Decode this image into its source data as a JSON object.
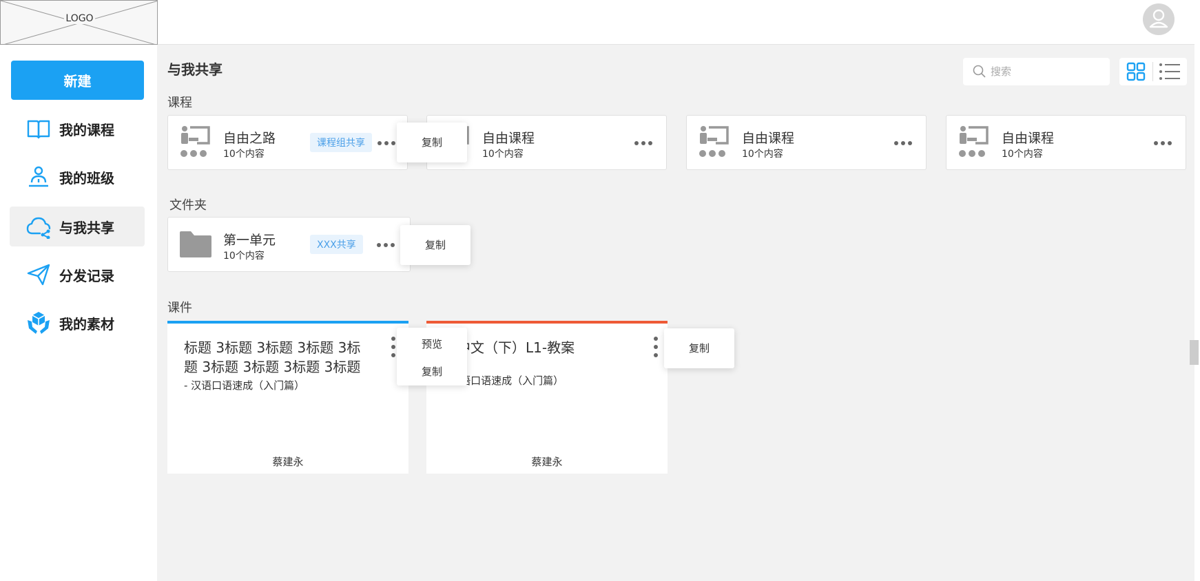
{
  "header": {
    "logo_text": "LOGO"
  },
  "sidebar": {
    "new_label": "新建",
    "items": [
      {
        "label": "我的课程",
        "icon": "book-icon"
      },
      {
        "label": "我的班级",
        "icon": "user-class-icon"
      },
      {
        "label": "与我共享",
        "icon": "cloud-share-icon",
        "active": true
      },
      {
        "label": "分发记录",
        "icon": "paper-plane-icon"
      },
      {
        "label": "我的素材",
        "icon": "material-hands-icon"
      }
    ]
  },
  "main": {
    "title": "与我共享",
    "search_placeholder": "搜索",
    "sections": {
      "courses": "课程",
      "folders": "文件夹",
      "coursewares": "课件"
    },
    "courses": [
      {
        "title": "自由之路",
        "sub": "10个内容",
        "tag": "课程组共享"
      },
      {
        "title": "自由课程",
        "sub": "10个内容"
      },
      {
        "title": "自由课程",
        "sub": "10个内容"
      },
      {
        "title": "自由课程",
        "sub": "10个内容"
      }
    ],
    "course_popup": {
      "copy": "复制"
    },
    "folders": [
      {
        "title": "第一单元",
        "sub": "10个内容",
        "tag": "XXX共享"
      }
    ],
    "folder_popup": {
      "copy": "复制"
    },
    "coursewares": [
      {
        "title": "标题 3标题 3标题 3标题 3标题 3标题 3标题 3标题 3标题",
        "sub": "- 汉语口语速成（入门篇）",
        "author": "蔡建永",
        "accent": "#1ba1f3"
      },
      {
        "title": "唯中文（下）L1-教案",
        "sub": "- 汉语口语速成（入门篇）",
        "author": "蔡建永",
        "accent": "#ee5a36"
      }
    ],
    "ware_popup_1": {
      "preview": "预览",
      "copy": "复制"
    },
    "ware_popup_2": {
      "copy": "复制"
    }
  },
  "colors": {
    "primary": "#1ba1f3",
    "accent_red": "#ee5a36",
    "tag_bg": "#e8f3fd",
    "background": "#f2f2f2"
  }
}
